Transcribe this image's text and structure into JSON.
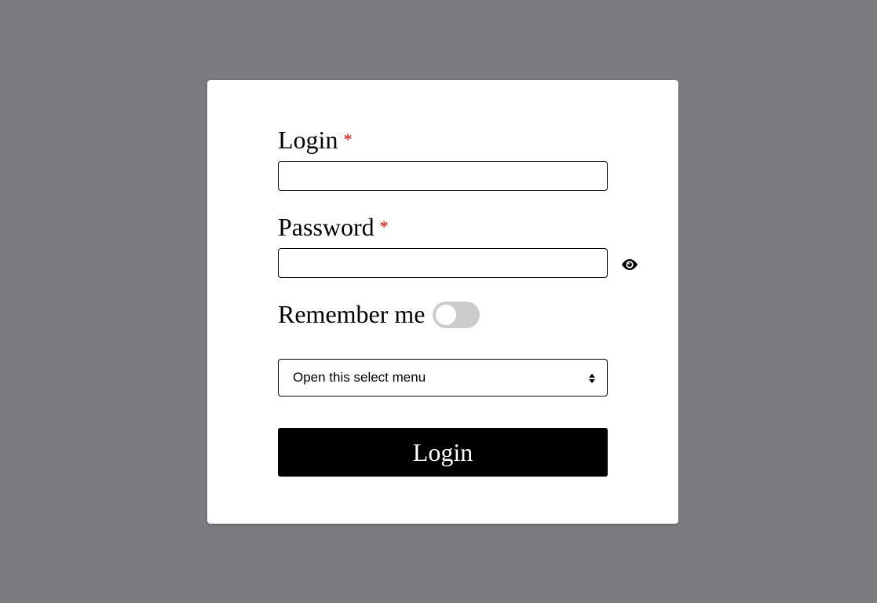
{
  "form": {
    "login_label": "Login",
    "login_required_mark": "*",
    "login_value": "",
    "password_label": "Password",
    "password_required_mark": "*",
    "password_value": "",
    "show_password_icon": "eye-icon",
    "remember_label": "Remember me",
    "remember_checked": false,
    "select_value": "Open this select menu",
    "submit_label": "Login"
  },
  "colors": {
    "background": "#7a7b7f",
    "card": "#ffffff",
    "required": "#e00000",
    "button": "#000000",
    "button_text": "#ffffff",
    "toggle_off": "#cccccc"
  }
}
